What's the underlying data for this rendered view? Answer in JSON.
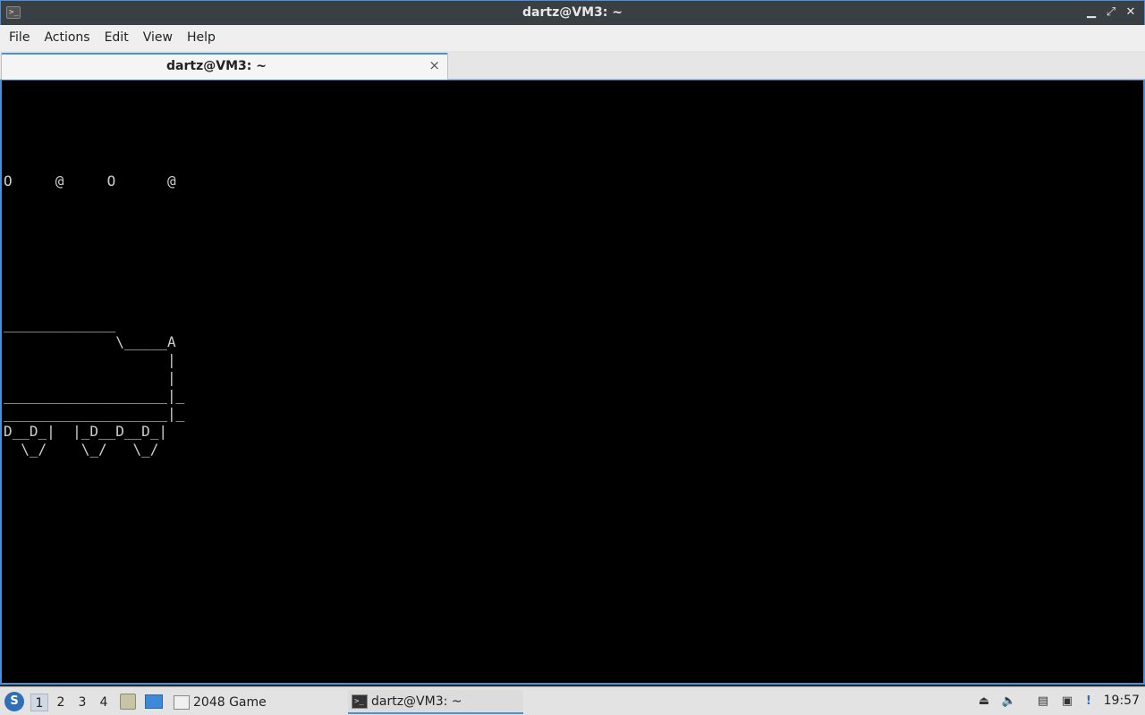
{
  "window": {
    "title": "dartz@VM3: ~",
    "app_icon_glyph": ">_",
    "buttons": {
      "minimize": "▁",
      "maximize": "⤢",
      "close": "✕"
    }
  },
  "menubar": {
    "items": [
      {
        "label": "File"
      },
      {
        "label": "Actions"
      },
      {
        "label": "Edit"
      },
      {
        "label": "View"
      },
      {
        "label": "Help"
      }
    ]
  },
  "tabs": [
    {
      "label": "dartz@VM3: ~",
      "close": "×"
    }
  ],
  "terminal": {
    "lines": [
      "O     @     O      @",
      "_____________",
      "             \\_____A",
      "                   |",
      "                   |",
      "___________________|_",
      "___________________|_",
      "D__D_|  |_D__D__D_|",
      "  \\_/    \\_/   \\_/"
    ]
  },
  "taskbar": {
    "start_glyph": "S",
    "workspaces": [
      "1",
      "2",
      "3",
      "4"
    ],
    "active_workspace": "1",
    "tasks": [
      {
        "label": "2048 Game",
        "icon": "window-icon"
      },
      {
        "label": "dartz@VM3: ~",
        "icon": "terminal-icon"
      }
    ],
    "tray": {
      "eject": "⏏",
      "volume": "🔈",
      "clipboard": "▤",
      "network": "▣",
      "updates": "!"
    },
    "clock": "19:57"
  }
}
